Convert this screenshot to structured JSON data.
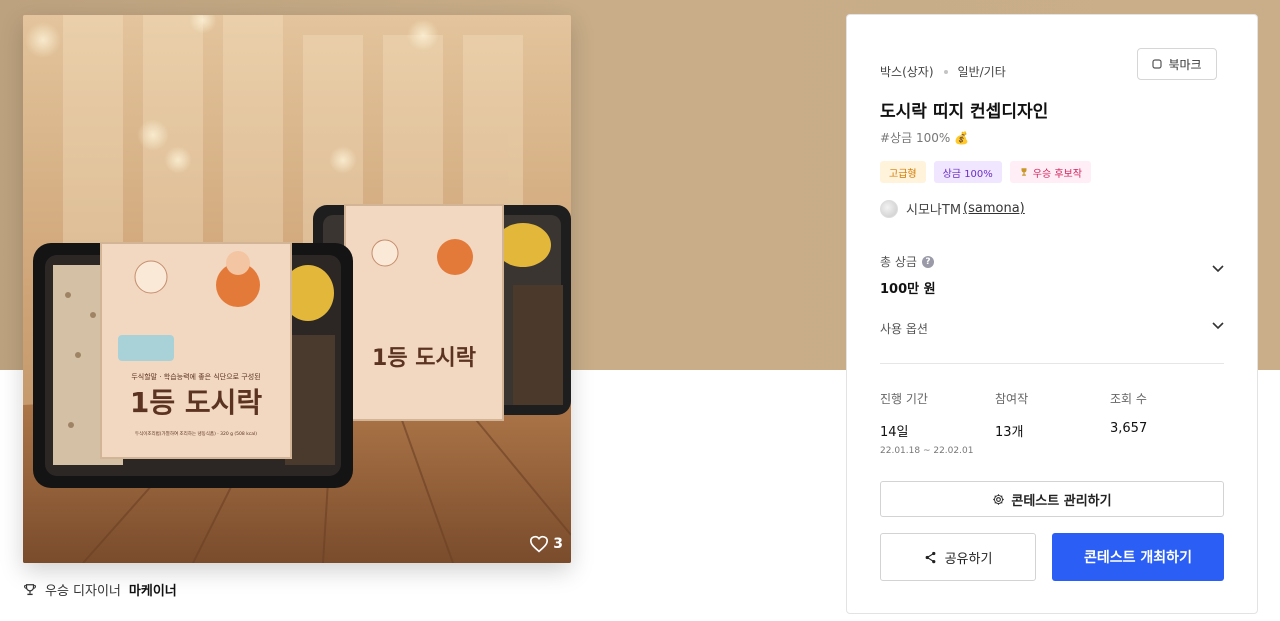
{
  "product": {
    "like_count": "3",
    "package_texts": {
      "main_title": "1등 도시락",
      "subtitle": "두식할말 · 학습능력에 좋은 식단으로 구성된",
      "footer": "두식이조리법(가열하여 조리하는 냉동식품) · 320 g (508 kcal)"
    }
  },
  "winner": {
    "label": "우승 디자이너",
    "name": "마케이너"
  },
  "panel": {
    "breadcrumb": [
      "박스(상자)",
      "일반/기타"
    ],
    "bookmark_label": "북마크",
    "title": "도시락 띠지 컨셉디자인",
    "tagline": "#상금 100% 💰",
    "badges": {
      "premium": "고급형",
      "prize": "상금 100%",
      "winner": "우승 후보작"
    },
    "designer": {
      "name": "시모나TM",
      "handle": "(samona)"
    },
    "total_prize": {
      "label": "총 상금",
      "value": "100만 원"
    },
    "usage_option": {
      "label": "사용 옵션"
    },
    "stats": {
      "period_label": "진행 기간",
      "period_value": "14일",
      "period_range": "22.01.18 ~ 22.02.01",
      "entries_label": "참여작",
      "entries_value": "13개",
      "views_label": "조회 수",
      "views_value": "3,657"
    },
    "manage_label": "콘테스트 관리하기",
    "share_label": "공유하기",
    "open_label": "콘테스트 개최하기"
  },
  "colors": {
    "primary": "#2a5ef5",
    "hero_bg": "#c8ad88"
  }
}
